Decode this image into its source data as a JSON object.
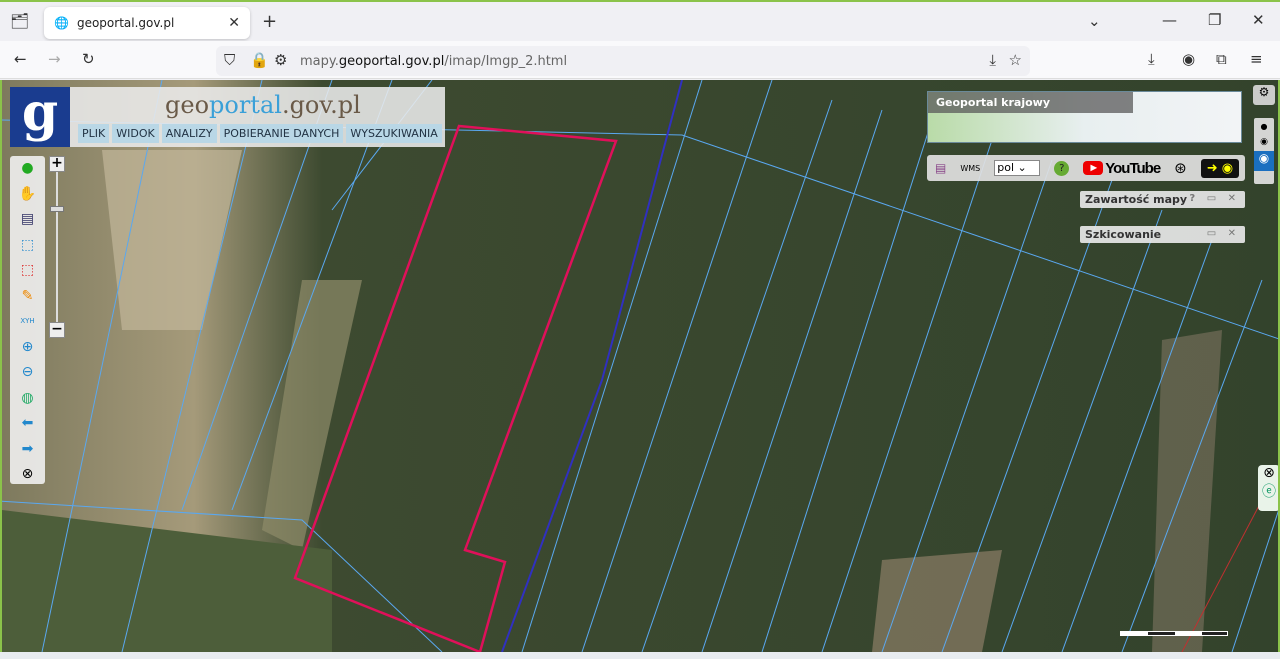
{
  "browser": {
    "tab_title": "geoportal.gov.pl",
    "url_prefix": "mapy.",
    "url_domain": "geoportal.gov.pl",
    "url_path": "/imap/Imgp_2.html"
  },
  "header": {
    "logo_letter": "g",
    "site_name_1": "geo",
    "site_name_2": "portal",
    "site_name_3": ".gov.pl",
    "menu": [
      "PLIK",
      "WIDOK",
      "ANALIZY",
      "POBIERANIE DANYCH",
      "WYSZUKIWANIA"
    ]
  },
  "toolbar": {
    "icons": [
      "info-icon",
      "pan-hand-icon",
      "legend-icon",
      "select-icon",
      "select-red-icon",
      "pencil-icon",
      "xyh-icon",
      "zoom-in-icon",
      "zoom-out-icon",
      "globe-icon",
      "back-arrow-icon",
      "forward-arrow-icon",
      "compass-icon"
    ],
    "xyh_label": "XYH"
  },
  "overview": {
    "title": "Geoportal krajowy"
  },
  "top_tools": {
    "language": "pol",
    "youtube": "YouTube",
    "help": "?"
  },
  "panels": [
    {
      "title": "Zawartość mapy",
      "controls": "? ▭ ✕"
    },
    {
      "title": "Szkicowanie",
      "controls": "▭ ✕"
    }
  ],
  "colors": {
    "accent": "#1a3c8f",
    "parcel_lines": "#5aa8f0",
    "selected_parcel": "#e0105a",
    "road_line": "#3030c0"
  }
}
